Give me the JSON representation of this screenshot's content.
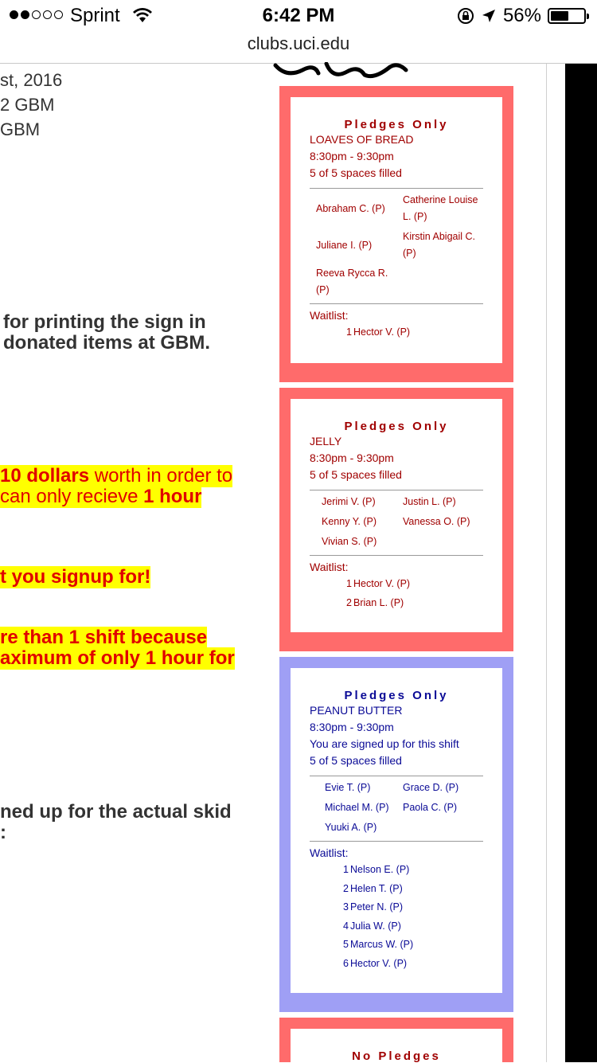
{
  "status_bar": {
    "carrier": "Sprint",
    "time": "6:42 PM",
    "battery": "56%",
    "battery_level": 0.56
  },
  "browser": {
    "url": "clubs.uci.edu"
  },
  "left_text": {
    "line1": "st, 2016",
    "line2": "2 GBM",
    "line3": "GBM",
    "bold1": "for printing the sign in",
    "bold2": "donated items at GBM.",
    "hl1_bold": "10 dollars",
    "hl1_rest": " worth in order to",
    "hl2_pre": "can only recieve ",
    "hl2_bold": "1 hour",
    "hl3": "t you signup for!",
    "hl4": "re than 1 shift because",
    "hl5": "aximum of only 1 hour for",
    "bold3": "ned up for the actual skid",
    "bold4": ":"
  },
  "cards": [
    {
      "title": "Pledges Only",
      "item": "LOAVES OF BREAD",
      "time": "8:30pm - 9:30pm",
      "filled": "5 of 5 spaces filled",
      "names": [
        "Abraham C. (P)",
        "Catherine Louise L. (P)",
        "Juliane I. (P)",
        "Kirstin Abigail C. (P)",
        "Reeva Rycca R. (P)"
      ],
      "waitlist_label": "Waitlist:",
      "waitlist": [
        {
          "n": "1",
          "name": "Hector V. (P)"
        }
      ]
    },
    {
      "title": "Pledges Only",
      "item": "JELLY",
      "time": "8:30pm - 9:30pm",
      "filled": "5 of 5 spaces filled",
      "names": [
        "Jerimi V. (P)",
        "Justin L. (P)",
        "Kenny Y. (P)",
        "Vanessa O. (P)",
        "Vivian S. (P)"
      ],
      "waitlist_label": "Waitlist:",
      "waitlist": [
        {
          "n": "1",
          "name": "Hector V. (P)"
        },
        {
          "n": "2",
          "name": "Brian L. (P)"
        }
      ]
    },
    {
      "title": "Pledges Only",
      "item": "PEANUT BUTTER",
      "time": "8:30pm - 9:30pm",
      "signed_up": "You are signed up for this shift",
      "filled": "5 of 5 spaces filled",
      "names": [
        "Evie T. (P)",
        "Grace D. (P)",
        "Michael M. (P)",
        "Paola C. (P)",
        "Yuuki A. (P)"
      ],
      "waitlist_label": "Waitlist:",
      "waitlist": [
        {
          "n": "1",
          "name": "Nelson E. (P)"
        },
        {
          "n": "2",
          "name": "Helen T. (P)"
        },
        {
          "n": "3",
          "name": "Peter N. (P)"
        },
        {
          "n": "4",
          "name": "Julia W. (P)"
        },
        {
          "n": "5",
          "name": "Marcus W. (P)"
        },
        {
          "n": "6",
          "name": "Hector V. (P)"
        }
      ]
    },
    {
      "title": "No Pledges"
    }
  ],
  "colors": {
    "red_card": "#ff6b6b",
    "blue_card": "#9f9ff5",
    "red_text": "#a00000",
    "blue_text": "#0a0a96",
    "highlight": "#ffff00",
    "highlight_text": "#e00000"
  }
}
